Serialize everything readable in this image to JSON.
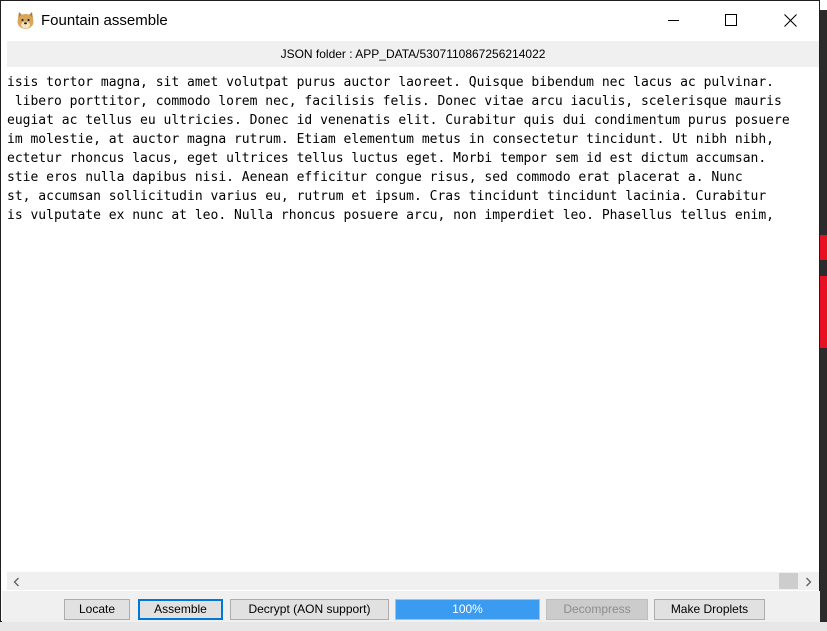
{
  "window": {
    "title": "Fountain assemble",
    "icon": "doge-app-icon",
    "controls": {
      "minimize": "minimize-icon",
      "maximize": "maximize-icon",
      "close": "close-icon"
    }
  },
  "folder_bar": {
    "text": "JSON folder : APP_DATA/5307110867256214022"
  },
  "text_view": {
    "lines": [
      "isis tortor magna, sit amet volutpat purus auctor laoreet. Quisque bibendum nec lacus ac pulvinar.",
      " libero porttitor, commodo lorem nec, facilisis felis. Donec vitae arcu iaculis, scelerisque mauris",
      "eugiat ac tellus eu ultricies. Donec id venenatis elit. Curabitur quis dui condimentum purus posuere",
      "im molestie, at auctor magna rutrum. Etiam elementum metus in consectetur tincidunt. Ut nibh nibh,",
      "ectetur rhoncus lacus, eget ultrices tellus luctus eget. Morbi tempor sem id est dictum accumsan.",
      "stie eros nulla dapibus nisi. Aenean efficitur congue risus, sed commodo erat placerat a. Nunc",
      "st, accumsan sollicitudin varius eu, rutrum et ipsum. Cras tincidunt tincidunt lacinia. Curabitur",
      "is vulputate ex nunc at leo. Nulla rhoncus posuere arcu, non imperdiet leo. Phasellus tellus enim,"
    ]
  },
  "buttons": {
    "locate": "Locate",
    "assemble": "Assemble",
    "decrypt": "Decrypt (AON support)",
    "decompress": "Decompress",
    "make_droplets": "Make Droplets"
  },
  "progress": {
    "label": "100%",
    "value": 1.0
  },
  "colors": {
    "progress_fill": "#3b9bf0",
    "focus_border": "#0078d7",
    "close_red": "#e81123"
  }
}
